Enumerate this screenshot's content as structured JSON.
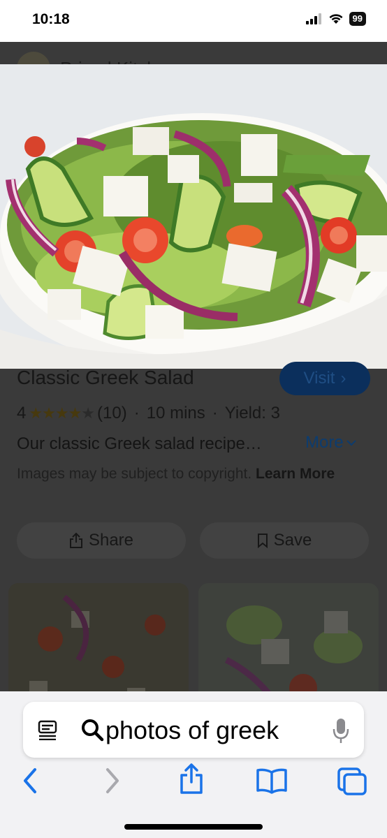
{
  "status_bar": {
    "time": "10:18",
    "battery": "99"
  },
  "page": {
    "site_name": "Primal Kitchen",
    "title": "Classic Greek Salad",
    "visit_label": "Visit",
    "rating_value": "4",
    "rating_stars": 4,
    "review_count": "(10)",
    "time": "10 mins",
    "yield": "Yield: 3",
    "separator": "·",
    "description": "Our classic Greek salad recipe…",
    "more_label": "More",
    "copyright_text": "Images may be subject to copyright.",
    "learn_more": "Learn More",
    "share_label": "Share",
    "save_label": "Save"
  },
  "browser": {
    "url_text": "photos of greek",
    "icons": [
      "reader-icon",
      "search-icon",
      "mic-icon",
      "back-icon",
      "forward-icon",
      "share-icon",
      "bookmarks-icon",
      "tabs-icon"
    ],
    "accent": "#1a73e8"
  }
}
